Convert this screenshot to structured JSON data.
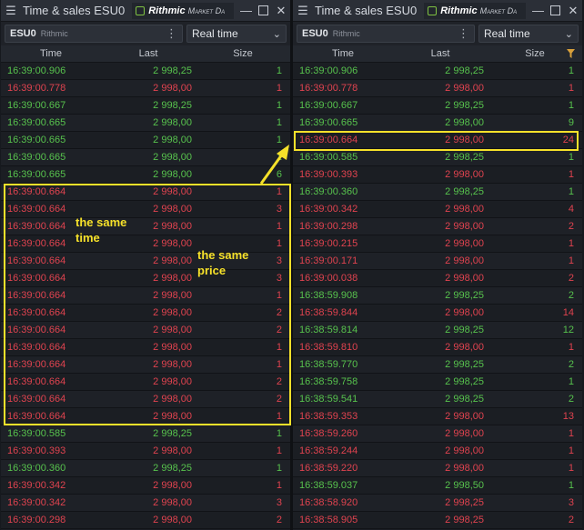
{
  "panels": [
    {
      "title": "Time & sales ESU0",
      "brand_name": "Rithmic",
      "brand_tag": "Market Da",
      "symbol": "ESU0",
      "symbol_source": "Rithmic",
      "mode": "Real time",
      "columns": [
        "Time",
        "Last",
        "Size"
      ],
      "rows": [
        {
          "t": "16:39:00.906",
          "p": "2 998,25",
          "s": "1",
          "side": "buy"
        },
        {
          "t": "16:39:00.778",
          "p": "2 998,00",
          "s": "1",
          "side": "sell"
        },
        {
          "t": "16:39:00.667",
          "p": "2 998,25",
          "s": "1",
          "side": "buy"
        },
        {
          "t": "16:39:00.665",
          "p": "2 998,00",
          "s": "1",
          "side": "buy"
        },
        {
          "t": "16:39:00.665",
          "p": "2 998,00",
          "s": "1",
          "side": "buy"
        },
        {
          "t": "16:39:00.665",
          "p": "2 998,00",
          "s": "1",
          "side": "buy"
        },
        {
          "t": "16:39:00.665",
          "p": "2 998,00",
          "s": "6",
          "side": "buy"
        },
        {
          "t": "16:39:00.664",
          "p": "2 998,00",
          "s": "1",
          "side": "sell"
        },
        {
          "t": "16:39:00.664",
          "p": "2 998,00",
          "s": "3",
          "side": "sell"
        },
        {
          "t": "16:39:00.664",
          "p": "2 998,00",
          "s": "1",
          "side": "sell"
        },
        {
          "t": "16:39:00.664",
          "p": "2 998,00",
          "s": "1",
          "side": "sell"
        },
        {
          "t": "16:39:00.664",
          "p": "2 998,00",
          "s": "3",
          "side": "sell"
        },
        {
          "t": "16:39:00.664",
          "p": "2 998,00",
          "s": "3",
          "side": "sell"
        },
        {
          "t": "16:39:00.664",
          "p": "2 998,00",
          "s": "1",
          "side": "sell"
        },
        {
          "t": "16:39:00.664",
          "p": "2 998,00",
          "s": "2",
          "side": "sell"
        },
        {
          "t": "16:39:00.664",
          "p": "2 998,00",
          "s": "2",
          "side": "sell"
        },
        {
          "t": "16:39:00.664",
          "p": "2 998,00",
          "s": "1",
          "side": "sell"
        },
        {
          "t": "16:39:00.664",
          "p": "2 998,00",
          "s": "1",
          "side": "sell"
        },
        {
          "t": "16:39:00.664",
          "p": "2 998,00",
          "s": "2",
          "side": "sell"
        },
        {
          "t": "16:39:00.664",
          "p": "2 998,00",
          "s": "2",
          "side": "sell"
        },
        {
          "t": "16:39:00.664",
          "p": "2 998,00",
          "s": "1",
          "side": "sell"
        },
        {
          "t": "16:39:00.585",
          "p": "2 998,25",
          "s": "1",
          "side": "buy"
        },
        {
          "t": "16:39:00.393",
          "p": "2 998,00",
          "s": "1",
          "side": "sell"
        },
        {
          "t": "16:39:00.360",
          "p": "2 998,25",
          "s": "1",
          "side": "buy"
        },
        {
          "t": "16:39:00.342",
          "p": "2 998,00",
          "s": "1",
          "side": "sell"
        },
        {
          "t": "16:39:00.342",
          "p": "2 998,00",
          "s": "3",
          "side": "sell"
        },
        {
          "t": "16:39:00.298",
          "p": "2 998,00",
          "s": "2",
          "side": "sell"
        }
      ]
    },
    {
      "title": "Time & sales ESU0",
      "brand_name": "Rithmic",
      "brand_tag": "Market Da",
      "symbol": "ESU0",
      "symbol_source": "Rithmic",
      "mode": "Real time",
      "columns": [
        "Time",
        "Last",
        "Size"
      ],
      "rows": [
        {
          "t": "16:39:00.906",
          "p": "2 998,25",
          "s": "1",
          "side": "buy"
        },
        {
          "t": "16:39:00.778",
          "p": "2 998,00",
          "s": "1",
          "side": "sell"
        },
        {
          "t": "16:39:00.667",
          "p": "2 998,25",
          "s": "1",
          "side": "buy"
        },
        {
          "t": "16:39:00.665",
          "p": "2 998,00",
          "s": "9",
          "side": "buy"
        },
        {
          "t": "16:39:00.664",
          "p": "2 998,00",
          "s": "24",
          "side": "sell"
        },
        {
          "t": "16:39:00.585",
          "p": "2 998,25",
          "s": "1",
          "side": "buy"
        },
        {
          "t": "16:39:00.393",
          "p": "2 998,00",
          "s": "1",
          "side": "sell"
        },
        {
          "t": "16:39:00.360",
          "p": "2 998,25",
          "s": "1",
          "side": "buy"
        },
        {
          "t": "16:39:00.342",
          "p": "2 998,00",
          "s": "4",
          "side": "sell"
        },
        {
          "t": "16:39:00.298",
          "p": "2 998,00",
          "s": "2",
          "side": "sell"
        },
        {
          "t": "16:39:00.215",
          "p": "2 998,00",
          "s": "1",
          "side": "sell"
        },
        {
          "t": "16:39:00.171",
          "p": "2 998,00",
          "s": "1",
          "side": "sell"
        },
        {
          "t": "16:39:00.038",
          "p": "2 998,00",
          "s": "2",
          "side": "sell"
        },
        {
          "t": "16:38:59.908",
          "p": "2 998,25",
          "s": "2",
          "side": "buy"
        },
        {
          "t": "16:38:59.844",
          "p": "2 998,00",
          "s": "14",
          "side": "sell"
        },
        {
          "t": "16:38:59.814",
          "p": "2 998,25",
          "s": "12",
          "side": "buy"
        },
        {
          "t": "16:38:59.810",
          "p": "2 998,00",
          "s": "1",
          "side": "sell"
        },
        {
          "t": "16:38:59.770",
          "p": "2 998,25",
          "s": "2",
          "side": "buy"
        },
        {
          "t": "16:38:59.758",
          "p": "2 998,25",
          "s": "1",
          "side": "buy"
        },
        {
          "t": "16:38:59.541",
          "p": "2 998,25",
          "s": "2",
          "side": "buy"
        },
        {
          "t": "16:38:59.353",
          "p": "2 998,00",
          "s": "13",
          "side": "sell"
        },
        {
          "t": "16:38:59.260",
          "p": "2 998,00",
          "s": "1",
          "side": "sell"
        },
        {
          "t": "16:38:59.244",
          "p": "2 998,00",
          "s": "1",
          "side": "sell"
        },
        {
          "t": "16:38:59.220",
          "p": "2 998,00",
          "s": "1",
          "side": "sell"
        },
        {
          "t": "16:38:59.037",
          "p": "2 998,50",
          "s": "1",
          "side": "buy"
        },
        {
          "t": "16:38:58.920",
          "p": "2 998,25",
          "s": "3",
          "side": "sell"
        },
        {
          "t": "16:38:58.905",
          "p": "2 998,25",
          "s": "2",
          "side": "sell"
        }
      ]
    }
  ],
  "annotations": {
    "same_time": "the same\ntime",
    "same_price": "the same\nprice"
  },
  "colors": {
    "buy": "#57c24d",
    "sell": "#e0434f",
    "highlight": "#f6e12a",
    "brand": "#7fc242",
    "filter": "#d9a13b"
  }
}
